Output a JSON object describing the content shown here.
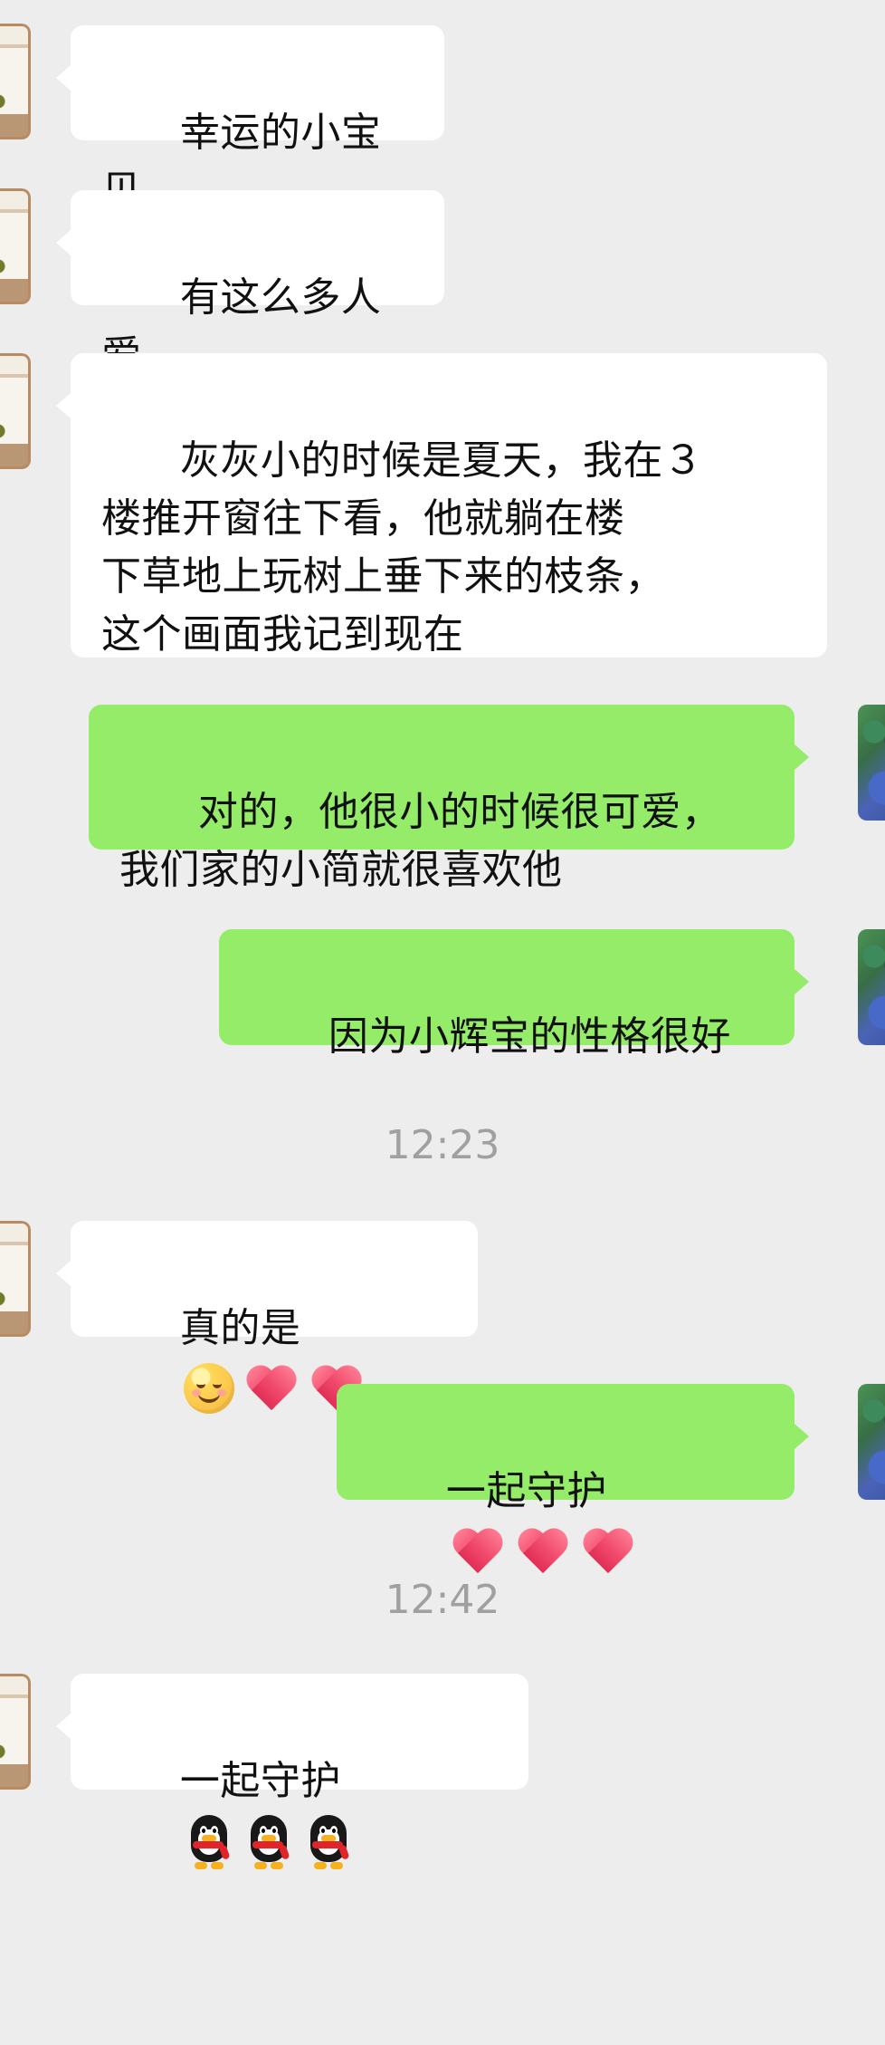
{
  "messages": [
    {
      "side": "left",
      "text": "幸运的小宝贝"
    },
    {
      "side": "left",
      "text": "有这么多人爱"
    },
    {
      "side": "left",
      "text": "灰灰小的时候是夏天，我在３\n楼推开窗往下看，他就躺在楼\n下草地上玩树上垂下来的枝条，\n这个画面我记到现在"
    },
    {
      "side": "right",
      "text": "对的，他很小的时候很可爱，\n我们家的小简就很喜欢他"
    },
    {
      "side": "right",
      "text": "因为小辉宝的性格很好"
    },
    {
      "side": "left",
      "text": "真的是",
      "emoji_names": [
        "smile-blush-icon",
        "heart-icon",
        "heart-icon"
      ]
    },
    {
      "side": "right",
      "text": "一起守护",
      "emoji_names": [
        "heart-icon",
        "heart-icon",
        "heart-icon"
      ]
    },
    {
      "side": "left",
      "text": "一起守护",
      "emoji_names": [
        "penguin-icon",
        "penguin-icon",
        "penguin-icon"
      ]
    }
  ],
  "timestamps": [
    "12:23",
    "12:42"
  ],
  "colors": {
    "background": "#ededed",
    "left_bubble": "#ffffff",
    "right_bubble": "#95ec69",
    "timestamp": "#a0a0a0"
  }
}
